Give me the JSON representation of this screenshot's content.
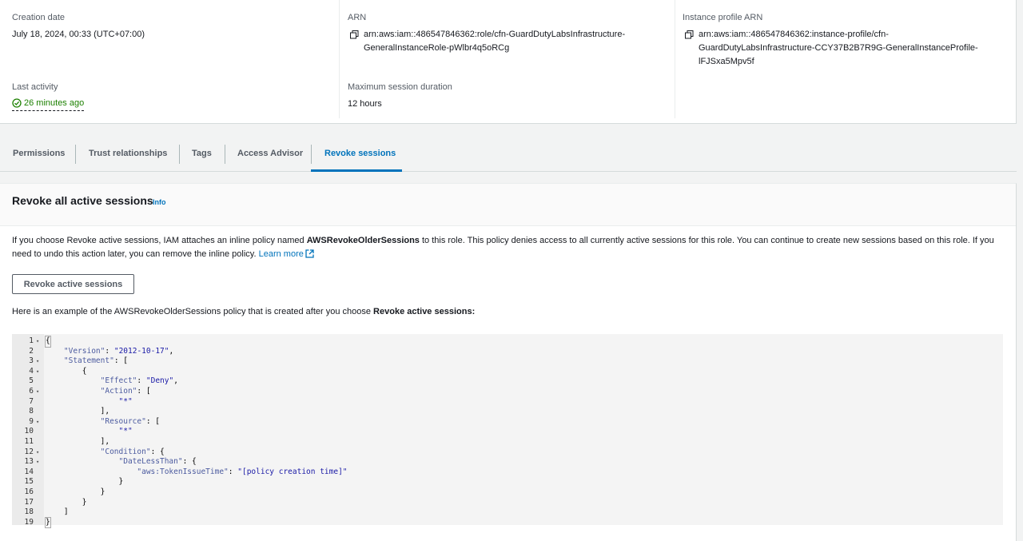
{
  "summary": {
    "creation_label": "Creation date",
    "creation_value": "July 18, 2024, 00:33 (UTC+07:00)",
    "last_activity_label": "Last activity",
    "last_activity_value": "26 minutes ago",
    "arn_label": "ARN",
    "arn_line1": "arn:aws:iam::486547846362:role/cfn-GuardDutyLabsInfrastructure-",
    "arn_line2": "GeneralInstanceRole-pWlbr4q5oRCg",
    "max_session_label": "Maximum session duration",
    "max_session_value": "12 hours",
    "profile_arn_label": "Instance profile ARN",
    "profile_arn_line1": "arn:aws:iam::486547846362:instance-profile/cfn-",
    "profile_arn_line2": "GuardDutyLabsInfrastructure-CCY37B2B7R9G-GeneralInstanceProfile-",
    "profile_arn_line3": "lFJSxa5Mpv5f"
  },
  "tabs": [
    {
      "label": "Permissions"
    },
    {
      "label": "Trust relationships"
    },
    {
      "label": "Tags"
    },
    {
      "label": "Access Advisor"
    },
    {
      "label": "Revoke sessions"
    }
  ],
  "panel": {
    "title": "Revoke all active sessions",
    "info": "Info",
    "para_part1": "If you choose Revoke active sessions, IAM attaches an inline policy named ",
    "para_bold": "AWSRevokeOlderSessions",
    "para_part2": " to this role. This policy denies access to all currently active sessions for this role. You can continue to create new sessions based on this role. If you need to undo this action later, you can remove the inline policy. ",
    "learn_more": "Learn more",
    "button": "Revoke active sessions",
    "example_part1": "Here is an example of the AWSRevokeOlderSessions policy that is created after you choose ",
    "example_bold": "Revoke active sessions:"
  },
  "code": {
    "lines": [
      {
        "n": "1",
        "text": "{"
      },
      {
        "n": "2",
        "text": "    \"Version\": \"2012-10-17\","
      },
      {
        "n": "3",
        "text": "    \"Statement\": ["
      },
      {
        "n": "4",
        "text": "        {"
      },
      {
        "n": "5",
        "text": "            \"Effect\": \"Deny\","
      },
      {
        "n": "6",
        "text": "            \"Action\": ["
      },
      {
        "n": "7",
        "text": "                \"*\""
      },
      {
        "n": "8",
        "text": "            ],"
      },
      {
        "n": "9",
        "text": "            \"Resource\": ["
      },
      {
        "n": "10",
        "text": "                \"*\""
      },
      {
        "n": "11",
        "text": "            ],"
      },
      {
        "n": "12",
        "text": "            \"Condition\": {"
      },
      {
        "n": "13",
        "text": "                \"DateLessThan\": {"
      },
      {
        "n": "14",
        "text": "                    \"aws:TokenIssueTime\": \"[policy creation time]\""
      },
      {
        "n": "15",
        "text": "                }"
      },
      {
        "n": "16",
        "text": "            }"
      },
      {
        "n": "17",
        "text": "        }"
      },
      {
        "n": "18",
        "text": "    ]"
      },
      {
        "n": "19",
        "text": "}"
      }
    ]
  }
}
